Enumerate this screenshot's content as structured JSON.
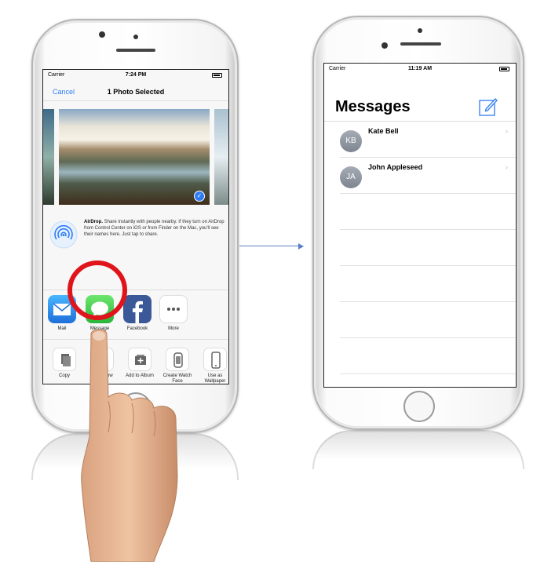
{
  "left_phone": {
    "status": {
      "carrier": "Carrier",
      "time": "7:24 PM"
    },
    "nav": {
      "cancel": "Cancel",
      "title": "1 Photo Selected"
    },
    "airdrop": {
      "heading": "AirDrop.",
      "body": "Share instantly with people nearby. If they turn on AirDrop from Control Center on iOS or from Finder on the Mac, you'll see their names here. Just tap to share."
    },
    "share_apps": [
      {
        "label": "Mail",
        "icon": "mail-icon"
      },
      {
        "label": "Message",
        "icon": "message-icon"
      },
      {
        "label": "Facebook",
        "icon": "facebook-icon"
      },
      {
        "label": "More",
        "icon": "more-icon"
      }
    ],
    "actions": [
      {
        "label": "Copy",
        "icon": "copy-icon"
      },
      {
        "label": "Slideshow",
        "icon": "slideshow-icon"
      },
      {
        "label": "Add to Album",
        "icon": "add-to-album-icon"
      },
      {
        "label": "Create Watch Face",
        "icon": "watch-face-icon"
      },
      {
        "label": "Use as Wallpaper",
        "icon": "wallpaper-icon"
      }
    ],
    "highlight_color": "#e0141b"
  },
  "right_phone": {
    "status": {
      "carrier": "Carrier",
      "time": "11:19 AM"
    },
    "title": "Messages",
    "contacts": [
      {
        "initials": "KB",
        "name": "Kate Bell"
      },
      {
        "initials": "JA",
        "name": "John Appleseed"
      }
    ]
  },
  "colors": {
    "ios_blue": "#2d7cf6",
    "arrow": "#5b7fc4"
  }
}
